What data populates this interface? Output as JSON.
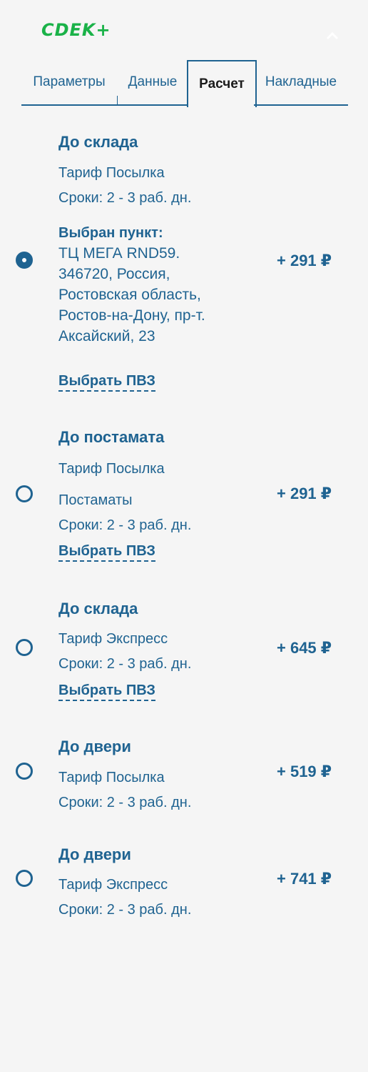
{
  "header": {
    "logo_text": "CDEK+",
    "brand_color": "#1ab248",
    "collapse_icon": "chevron-up-icon"
  },
  "tabs": [
    {
      "label": "Параметры",
      "active": false
    },
    {
      "label": "Данные",
      "active": false
    },
    {
      "label": "Расчет",
      "active": true
    },
    {
      "label": "Накладные",
      "active": false
    }
  ],
  "options": [
    {
      "title": "До склада",
      "tariff": "Тариф Посылка",
      "terms": "Сроки: 2 - 3 раб. дн.",
      "selected_label": "Выбран пункт:",
      "selected_address": "ТЦ МЕГА RND59. 346720, Россия, Ростовская область, Ростов-на-Дону, пр-т. Аксайский, 23",
      "link": "Выбрать ПВЗ",
      "price": "+ 291 ₽",
      "checked": true
    },
    {
      "title": "До постамата",
      "tariff": "Тариф Посылка",
      "extra": "Постаматы",
      "terms": "Сроки: 2 - 3 раб. дн.",
      "link": "Выбрать ПВЗ",
      "price": "+ 291 ₽",
      "checked": false
    },
    {
      "title": "До склада",
      "tariff": "Тариф Экспресс",
      "terms": "Сроки: 2 - 3 раб. дн.",
      "link": "Выбрать ПВЗ",
      "price": "+ 645 ₽",
      "checked": false
    },
    {
      "title": "До двери",
      "tariff": "Тариф Посылка",
      "terms": "Сроки: 2 - 3 раб. дн.",
      "price": "+ 519 ₽",
      "checked": false
    },
    {
      "title": "До двери",
      "tariff": "Тариф Экспресс",
      "terms": "Сроки: 2 - 3 раб. дн.",
      "price": "+ 741 ₽",
      "checked": false
    }
  ],
  "accent_color": "#1f6391"
}
